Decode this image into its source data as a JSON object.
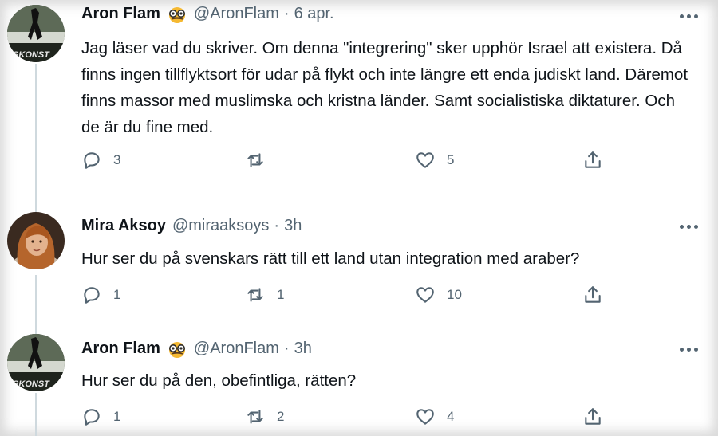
{
  "tweets": [
    {
      "author": "Aron Flam",
      "handle": "@AronFlam",
      "separator": "·",
      "time": "6 apr.",
      "text": "Jag läser vad du skriver. Om denna \"integrering\" sker upphör Israel att existera. Då finns ingen tillflyktsort för udar på flykt och inte längre ett enda judiskt land. Däremot finns massor med muslimska och kristna länder. Samt socialistiska diktaturer. Och de är du fine med.",
      "replies": "3",
      "retweets": "",
      "likes": "5",
      "avatar_text": "ISKONST"
    },
    {
      "author": "Mira Aksoy",
      "handle": "@miraaksoys",
      "separator": "·",
      "time": "3h",
      "text": "Hur ser du på svenskars rätt till ett land utan integration med araber?",
      "replies": "1",
      "retweets": "1",
      "likes": "10"
    },
    {
      "author": "Aron Flam",
      "handle": "@AronFlam",
      "separator": "·",
      "time": "3h",
      "text": "Hur ser du på den, obefintliga, rätten?",
      "replies": "1",
      "retweets": "2",
      "likes": "4",
      "avatar_text": "ISKONST"
    }
  ],
  "colors": {
    "text": "#0f1419",
    "muted": "#536471",
    "thread_line": "#cfd9de"
  },
  "icons": [
    "reply-icon",
    "retweet-icon",
    "like-icon",
    "share-icon",
    "more-icon",
    "disguise-emoji"
  ]
}
